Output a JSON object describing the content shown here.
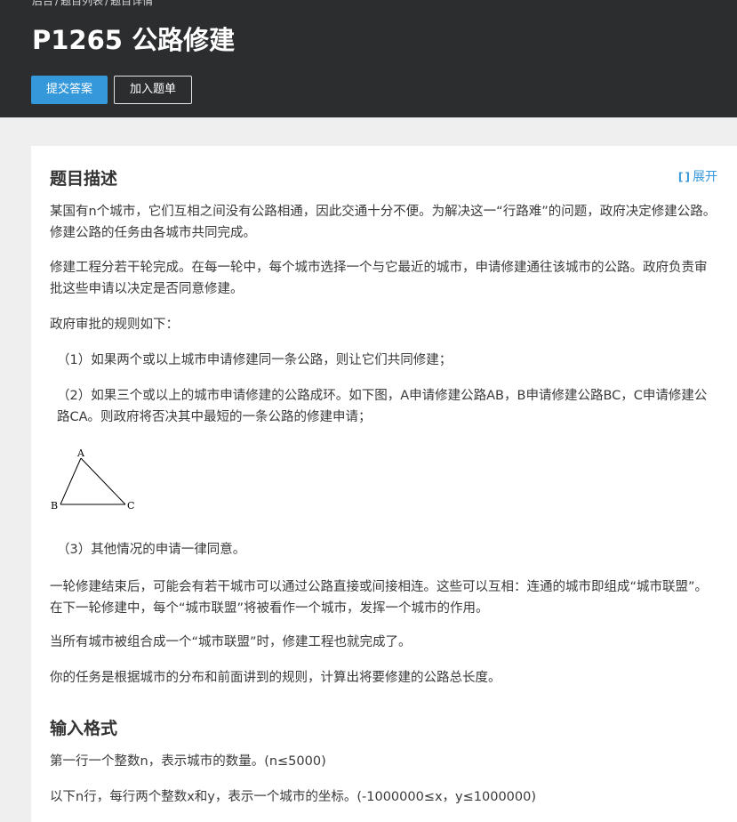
{
  "header": {
    "breadcrumb": [
      "后台",
      "/",
      "题目列表",
      "/",
      "题目详情"
    ],
    "title": "P1265 公路修建",
    "submit_label": "提交答案",
    "add_list_label": "加入题单"
  },
  "content": {
    "desc_title": "题目描述",
    "expand_icon": "[ ]",
    "expand_label": "展开",
    "paragraphs": [
      "某国有n个城市，它们互相之间没有公路相通，因此交通十分不便。为解决这一“行路难”的问题，政府决定修建公路。修建公路的任务由各城市共同完成。",
      "修建工程分若干轮完成。在每一轮中，每个城市选择一个与它最近的城市，申请修建通往该城市的公路。政府负责审批这些申请以决定是否同意修建。",
      "政府审批的规则如下：",
      "（1）如果两个或以上城市申请修建同一条公路，则让它们共同修建；",
      "（2）如果三个或以上的城市申请修建的公路成环。如下图，A申请修建公路AB，B申请修建公路BC，C申请修建公路CA。则政府将否决其中最短的一条公路的修建申请；",
      "（3）其他情况的申请一律同意。",
      "一轮修建结束后，可能会有若干城市可以通过公路直接或间接相连。这些可以互相：连通的城市即组成“城市联盟”。在下一轮修建中，每个“城市联盟”将被看作一个城市，发挥一个城市的作用。",
      "当所有城市被组合成一个“城市联盟”时，修建工程也就完成了。",
      "你的任务是根据城市的分布和前面讲到的规则，计算出将要修建的公路总长度。"
    ],
    "diagram_labels": {
      "a": "A",
      "b": "B",
      "c": "C"
    },
    "input_title": "输入格式",
    "input_paragraphs": [
      "第一行一个整数n，表示城市的数量。(n≤5000)",
      "以下n行，每行两个整数x和y，表示一个城市的坐标。(-1000000≤x，y≤1000000)"
    ]
  },
  "colors": {
    "header_bg": "#2c2d2f",
    "primary": "#3498db",
    "page_bg": "#efefef"
  }
}
